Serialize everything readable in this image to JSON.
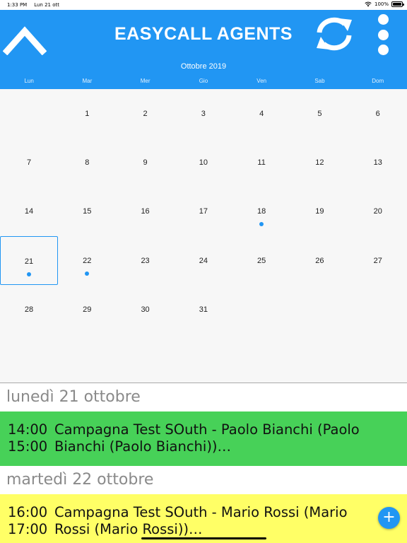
{
  "status_bar": {
    "time": "1:33 PM",
    "date": "Lun 21 ott",
    "battery": "100%"
  },
  "header": {
    "title": "EASYCALL AGENTS",
    "month": "Ottobre 2019",
    "weekdays": [
      "Lun",
      "Mar",
      "Mer",
      "Gio",
      "Ven",
      "Sab",
      "Dom"
    ]
  },
  "calendar": {
    "weeks": [
      [
        "",
        "1",
        "2",
        "3",
        "4",
        "5",
        "6"
      ],
      [
        "7",
        "8",
        "9",
        "10",
        "11",
        "12",
        "13"
      ],
      [
        "14",
        "15",
        "16",
        "17",
        "18",
        "19",
        "20"
      ],
      [
        "21",
        "22",
        "23",
        "24",
        "25",
        "26",
        "27"
      ],
      [
        "28",
        "29",
        "30",
        "31",
        "",
        "",
        ""
      ]
    ],
    "selected_day": "21",
    "days_with_events": [
      "18",
      "21",
      "22"
    ]
  },
  "agenda": [
    {
      "date_label": "lunedì 21 ottobre",
      "color": "#47d158",
      "start": "14:00",
      "end": "15:00",
      "line1": "Campagna Test SOuth - Paolo Bianchi (Paolo",
      "line2": "Bianchi (Paolo Bianchi))…"
    },
    {
      "date_label": "martedì 22 ottobre",
      "color": "#ffff66",
      "start": "16:00",
      "end": "17:00",
      "line1": "Campagna Test SOuth - Mario Rossi (Mario",
      "line2": "Rossi (Mario Rossi))…"
    }
  ],
  "fab": {
    "label": "+"
  },
  "colors": {
    "accent": "#2196f3",
    "calendar_bg": "#f7f7f7"
  }
}
